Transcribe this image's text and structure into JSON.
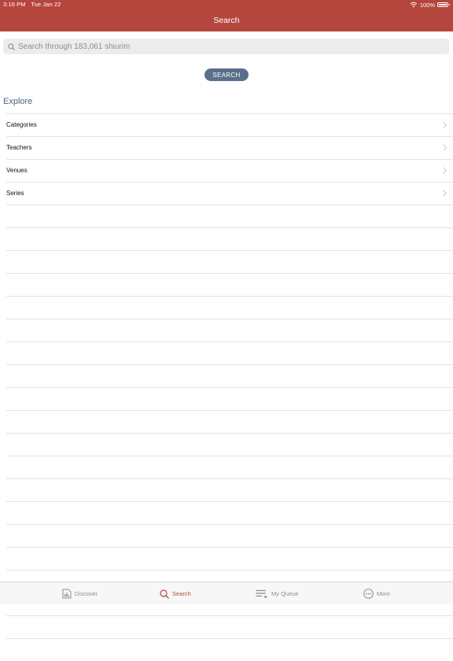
{
  "status_bar": {
    "time": "3:16 PM",
    "date": "Tue Jan 22",
    "battery": "100%"
  },
  "nav": {
    "title": "Search"
  },
  "search": {
    "placeholder": "Search through 183,061 shiurim",
    "button_label": "SEARCH"
  },
  "explore": {
    "heading": "Explore",
    "items": [
      {
        "label": "Categories"
      },
      {
        "label": "Teachers"
      },
      {
        "label": "Venues"
      },
      {
        "label": "Series"
      }
    ]
  },
  "tabs": [
    {
      "label": "Discover",
      "icon": "discover-icon",
      "active": false
    },
    {
      "label": "Search",
      "icon": "search-icon",
      "active": true
    },
    {
      "label": "My Queue",
      "icon": "queue-icon",
      "active": false
    },
    {
      "label": "More",
      "icon": "more-icon",
      "active": false
    }
  ],
  "colors": {
    "accent": "#b5463e",
    "button": "#5a6f8a",
    "heading": "#4d6685",
    "tab_inactive": "#8e8e93"
  }
}
